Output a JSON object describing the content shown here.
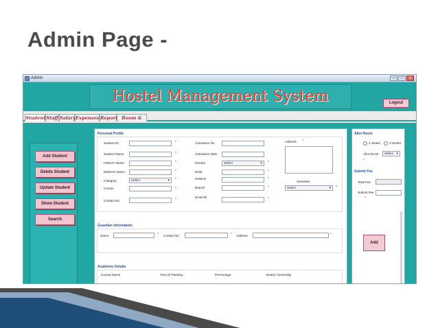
{
  "slide": {
    "title": "Admin Page -"
  },
  "window": {
    "title": "Admin",
    "controls": [
      "—",
      "□",
      "x"
    ]
  },
  "header": {
    "banner": "Hostel Management System",
    "logout_label": "Logout"
  },
  "tabs": [
    "Student",
    "Staff",
    "Salary",
    "Expenses",
    "Report",
    "Room & Fee"
  ],
  "sidebar": {
    "buttons": [
      "Add Student",
      "Delete Student",
      "Update Student",
      "Show Student",
      "Search"
    ]
  },
  "personal": {
    "title": "Personal Profile",
    "student_id": "Student ID",
    "admission_no": "Admission No.",
    "address": "Address",
    "student_name": "Student Name",
    "admission_date": "Admission Date",
    "fathers_name": "Father's Name",
    "gender": "Gender",
    "gender_value": "Select",
    "mothers_name": "Mother's Name",
    "dob": "DOB",
    "category": "Category",
    "category_value": "Select",
    "session": "Session",
    "course": "Course",
    "branch": "Branch",
    "semester": "Semester",
    "semester_value": "Select",
    "contact_no": "Contact No",
    "email_id": "Email ID",
    "required": "*"
  },
  "guardian": {
    "title": "Guardian Information",
    "name": "Name",
    "contact_no": "Contact No",
    "address": "Address"
  },
  "academic": {
    "title": "Academic Details",
    "columns": [
      "Course Name",
      "Year Of Passing",
      "Percentage",
      "Board / University"
    ]
  },
  "allot": {
    "title": "Allot Room",
    "option1": "2 Seater",
    "option2": "3 Seater",
    "allot_room": "Allot Room",
    "allot_value": "Select"
  },
  "fee": {
    "title": "Submit Fee",
    "total_fee": "Total Fee",
    "submit_fee": "Submit Fee",
    "add_label": "Add"
  }
}
